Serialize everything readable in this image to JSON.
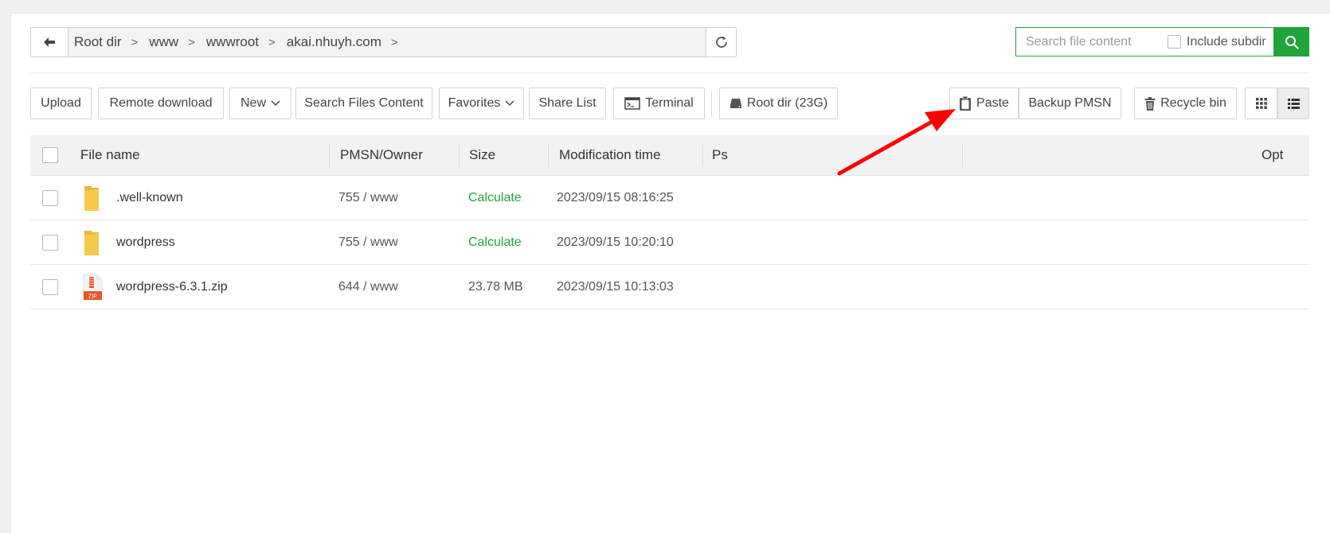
{
  "breadcrumb": {
    "items": [
      "Root dir",
      "www",
      "wwwroot",
      "akai.nhuyh.com"
    ],
    "separator": ">"
  },
  "search": {
    "placeholder": "Search file content",
    "include_subdir_label": "Include subdir"
  },
  "toolbar": {
    "upload": "Upload",
    "remote_download": "Remote download",
    "new": "New",
    "search_files_content": "Search Files Content",
    "favorites": "Favorites",
    "share_list": "Share List",
    "terminal": "Terminal",
    "root_dir": "Root dir (23G)",
    "paste": "Paste",
    "backup_pmsn": "Backup PMSN",
    "recycle_bin": "Recycle bin"
  },
  "table": {
    "columns": {
      "name": "File name",
      "owner": "PMSN/Owner",
      "size": "Size",
      "mtime": "Modification time",
      "ps": "Ps",
      "opt": "Opt"
    },
    "rows": [
      {
        "name": ".well-known",
        "type": "folder",
        "owner": "755 / www",
        "size": "Calculate",
        "mtime": "2023/09/15 08:16:25"
      },
      {
        "name": "wordpress",
        "type": "folder",
        "owner": "755 / www",
        "size": "Calculate",
        "mtime": "2023/09/15 10:20:10"
      },
      {
        "name": "wordpress-6.3.1.zip",
        "type": "zip",
        "owner": "644 / www",
        "size": "23.78 MB",
        "mtime": "2023/09/15 10:13:03"
      }
    ]
  },
  "colors": {
    "accent": "#20a53a",
    "arrow": "#ff0000",
    "folder": "#f6c84c"
  },
  "icons": [
    "back-arrow-icon",
    "refresh-icon",
    "search-icon",
    "chevron-down-icon",
    "terminal-icon",
    "disk-icon",
    "clipboard-icon",
    "trash-icon",
    "grid-view-icon",
    "list-view-icon",
    "folder-icon",
    "zip-file-icon"
  ]
}
